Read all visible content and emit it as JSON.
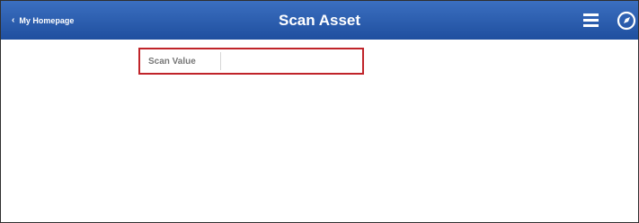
{
  "header": {
    "back_label": "My Homepage",
    "title": "Scan Asset",
    "menu_icon": "hamburger-menu-icon",
    "nav_icon": "navbar-compass-icon",
    "bar_color": "#2a5cae"
  },
  "form": {
    "scan_value_label": "Scan Value",
    "scan_value": "",
    "highlight_color": "#c0242a"
  }
}
